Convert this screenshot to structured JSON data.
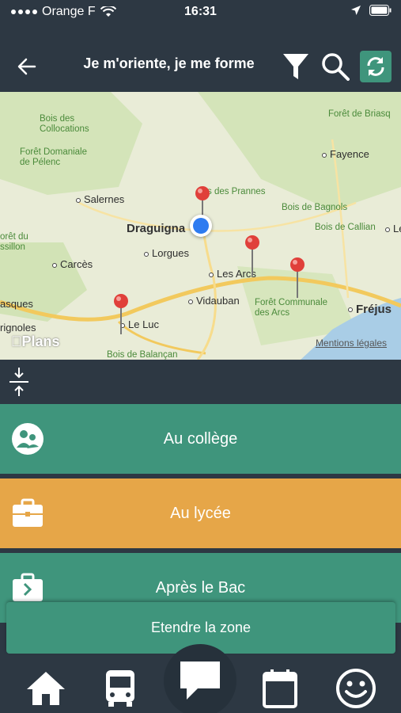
{
  "status": {
    "carrier": "Orange F",
    "time": "16:31"
  },
  "header": {
    "title": "Je m'oriente, je me forme"
  },
  "map": {
    "labels": {
      "bois_collocations": "Bois des\nCollocations",
      "foret_pelenc": "Forêt Domaniale\nde Pélenc",
      "salernes": "Salernes",
      "prannes": "s des Prannes",
      "draguignan": "Draguigna",
      "lorgues": "Lorgues",
      "carces": "Carcès",
      "les_arcs": "Les Arcs",
      "vidauban": "Vidauban",
      "foret_arcs": "Forêt Communale\ndes Arcs",
      "le_luc": "Le Luc",
      "bois_balancan": "Bois de Balançan",
      "fayence": "Fayence",
      "foret_briasq": "Forêt de Briasq",
      "bois_bagnols": "Bois de Bagnols",
      "bois_callian": "Bois de Callian",
      "le_mu": "Le Mu",
      "frejus": "Fréjus",
      "foret_du_roussillon": "orêt du\nssillon",
      "masques": "asques",
      "gnoles": "rignoles",
      "plans": "Plans",
      "legal": "Mentions légales"
    }
  },
  "menu": {
    "college": "Au collège",
    "lycee": "Au lycée",
    "apres_bac": "Après le Bac"
  },
  "extend_label": "Etendre la zone",
  "colors": {
    "teal": "#3f957c",
    "orange": "#e6a648",
    "dark": "#2d3843"
  }
}
